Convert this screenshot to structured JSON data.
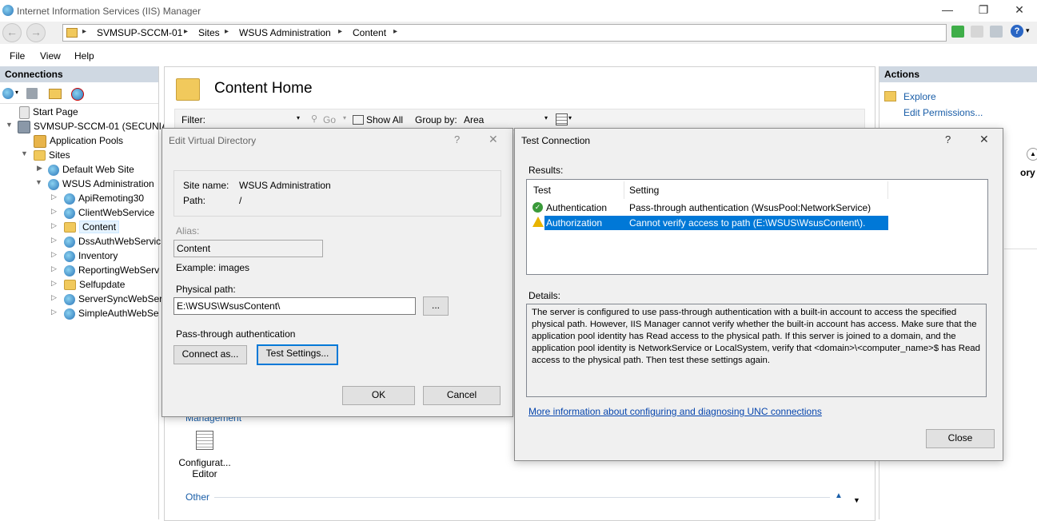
{
  "window": {
    "title": "Internet Information Services (IIS) Manager",
    "minimize": "—",
    "restore": "❐",
    "close": "✕"
  },
  "address": {
    "crumbs": [
      "SVMSUP-SCCM-01",
      "Sites",
      "WSUS Administration",
      "Content"
    ],
    "sep": "▸"
  },
  "menu": [
    "File",
    "View",
    "Help"
  ],
  "connections": {
    "header": "Connections",
    "tree": [
      {
        "label": "Start Page"
      },
      {
        "label": "SVMSUP-SCCM-01 (SECUNIA"
      },
      {
        "label": "Application Pools"
      },
      {
        "label": "Sites"
      },
      {
        "label": "Default Web Site"
      },
      {
        "label": "WSUS Administration"
      },
      {
        "label": "ApiRemoting30"
      },
      {
        "label": "ClientWebService"
      },
      {
        "label": "Content"
      },
      {
        "label": "DssAuthWebServic"
      },
      {
        "label": "Inventory"
      },
      {
        "label": "ReportingWebServ"
      },
      {
        "label": "Selfupdate"
      },
      {
        "label": "ServerSyncWebSer"
      },
      {
        "label": "SimpleAuthWebSe"
      }
    ]
  },
  "center": {
    "title": "Content Home",
    "filter_label": "Filter:",
    "go": "Go",
    "show_all": "Show All",
    "group_by": "Group by:",
    "group_value": "Area",
    "section_management": "Management",
    "config_editor": "Configurat...",
    "config_editor2": "Editor",
    "section_other": "Other"
  },
  "actions": {
    "header": "Actions",
    "explore": "Explore",
    "edit_permissions": "Edit Permissions...",
    "partial": "ory"
  },
  "evd": {
    "title": "Edit Virtual Directory",
    "help": "?",
    "close": "✕",
    "site_name_label": "Site name:",
    "site_name_value": "WSUS Administration",
    "path_label": "Path:",
    "path_value": "/",
    "alias_label": "Alias:",
    "alias_value": "Content",
    "example": "Example: images",
    "physical_label": "Physical path:",
    "physical_value": "E:\\WSUS\\WsusContent\\",
    "browse": "...",
    "passthrough": "Pass-through authentication",
    "connect_as": "Connect as...",
    "test_settings": "Test Settings...",
    "ok": "OK",
    "cancel": "Cancel"
  },
  "tc": {
    "title": "Test Connection",
    "help": "?",
    "close_x": "✕",
    "results_label": "Results:",
    "col_test": "Test",
    "col_setting": "Setting",
    "rows": [
      {
        "test": "Authentication",
        "setting": "Pass-through authentication (WsusPool:NetworkService)",
        "status": "ok"
      },
      {
        "test": "Authorization",
        "setting": "Cannot verify access to path (E:\\WSUS\\WsusContent\\).",
        "status": "warning"
      }
    ],
    "details_label": "Details:",
    "details_text": "The server is configured to use pass-through authentication with a built-in account to access the specified physical path. However, IIS Manager cannot verify whether the built-in account has access. Make sure that the application pool identity has Read access to the physical path. If this server is joined to a domain, and the application pool identity is NetworkService or LocalSystem, verify that <domain>\\<computer_name>$ has Read access to the physical path. Then test these settings again.",
    "more_link": "More information about configuring and diagnosing UNC connections",
    "close_btn": "Close"
  },
  "colors": {
    "accent": "#0078d7",
    "panel_header": "#cfd8e2",
    "link": "#1a5ea8"
  }
}
